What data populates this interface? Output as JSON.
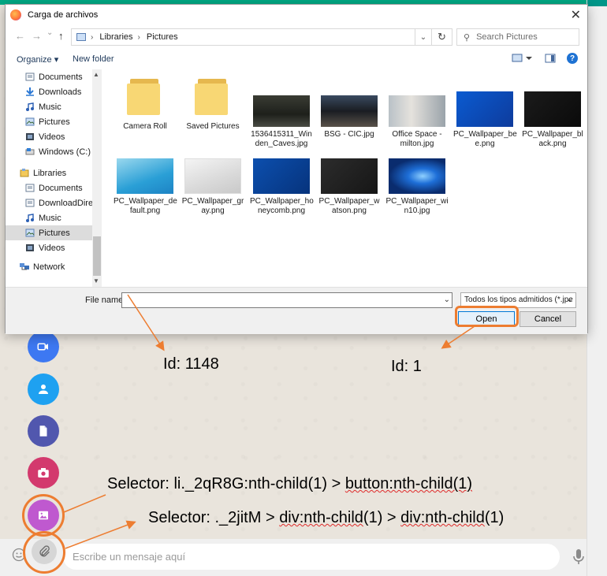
{
  "dialog": {
    "title": "Carga de archivos",
    "close": "✕",
    "nav": {
      "back": "←",
      "forward": "→",
      "recent": "⌄",
      "up": "↑"
    },
    "address": {
      "crumbs": [
        "Libraries",
        "Pictures"
      ],
      "separator": "›",
      "dropdown": "⌄",
      "refresh": "↻"
    },
    "search_placeholder": "Search Pictures",
    "toolbar": {
      "organize": "Organize ▾",
      "new_folder": "New folder"
    },
    "nav_pane": [
      {
        "label": "Documents",
        "icon": "documents-icon"
      },
      {
        "label": "Downloads",
        "icon": "downloads-icon"
      },
      {
        "label": "Music",
        "icon": "music-icon"
      },
      {
        "label": "Pictures",
        "icon": "pictures-icon"
      },
      {
        "label": "Videos",
        "icon": "videos-icon"
      },
      {
        "label": "Windows (C:)",
        "icon": "drive-icon"
      },
      {
        "label": "Libraries",
        "icon": "libraries-icon"
      },
      {
        "label": "Documents",
        "icon": "documents-icon"
      },
      {
        "label": "DownloadDirect",
        "icon": "documents-icon"
      },
      {
        "label": "Music",
        "icon": "music-icon"
      },
      {
        "label": "Pictures",
        "icon": "pictures-icon"
      },
      {
        "label": "Videos",
        "icon": "videos-icon"
      },
      {
        "label": "Network",
        "icon": "network-icon"
      }
    ],
    "files": [
      {
        "line1": "Camera Roll",
        "line2": "",
        "kind": "folder"
      },
      {
        "line1": "Saved Pictures",
        "line2": "",
        "kind": "folder"
      },
      {
        "line1": "1536415311_Win",
        "line2": "den_Caves.jpg",
        "kind": "dark-cave"
      },
      {
        "line1": "BSG - CIC.jpg",
        "line2": "",
        "kind": "dark-room"
      },
      {
        "line1": "Office Space -",
        "line2": "milton.jpg",
        "kind": "office"
      },
      {
        "line1": "PC_Wallpaper_be",
        "line2": "e.png",
        "kind": "blue"
      },
      {
        "line1": "PC_Wallpaper_bl",
        "line2": "ack.png",
        "kind": "black"
      },
      {
        "line1": "PC_Wallpaper_de",
        "line2": "fault.png",
        "kind": "teal"
      },
      {
        "line1": "PC_Wallpaper_gr",
        "line2": "ay.png",
        "kind": "gray"
      },
      {
        "line1": "PC_Wallpaper_ho",
        "line2": "neycomb.png",
        "kind": "navy"
      },
      {
        "line1": "PC_Wallpaper_w",
        "line2": "atson.png",
        "kind": "charcoal"
      },
      {
        "line1": "PC_Wallpaper_wi",
        "line2": "n10.jpg",
        "kind": "win10"
      }
    ],
    "file_name_label": "File name:",
    "file_name_value": "",
    "file_type": "Todos los tipos admitidos (*.jpe",
    "open_label": "Open",
    "cancel_label": "Cancel"
  },
  "composer": {
    "placeholder": "Escribe un mensaje aquí"
  },
  "annotations": {
    "id_input": "Id: 1148",
    "id_open": "Id: 1",
    "selector1_prefix": "Selector: li._2qR8G:nth-child(1) > ",
    "selector1_wavy": "button:nth-child(1)",
    "selector2_prefix": "Selector: ._2jitM > ",
    "selector2_wavy1": "div:nth-child",
    "selector2_mid": "(1) > ",
    "selector2_wavy2": "div:nth-child",
    "selector2_end": "(1)"
  },
  "colors": {
    "highlight": "#ed7d31",
    "whatsapp": "#00a884"
  }
}
